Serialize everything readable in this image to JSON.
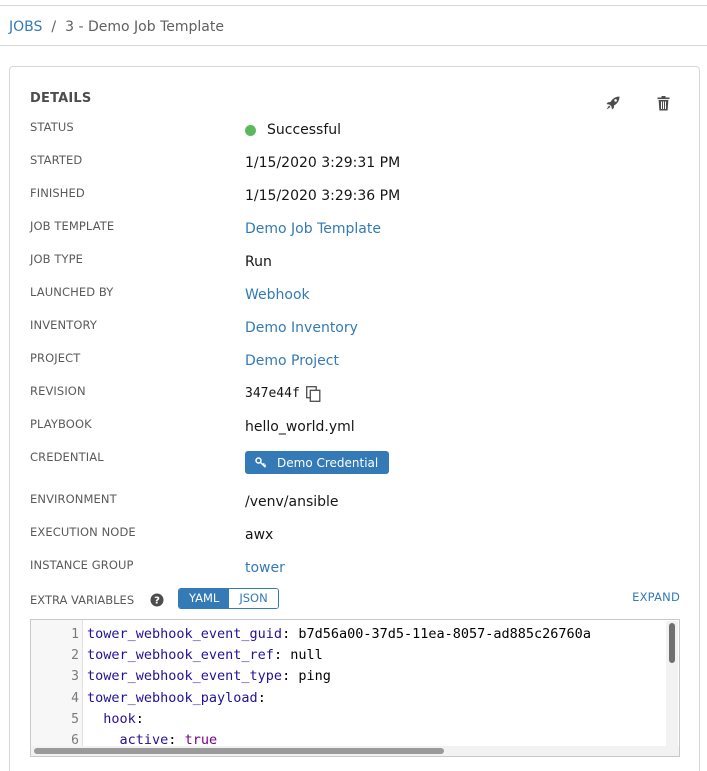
{
  "breadcrumb": {
    "root": "JOBS",
    "separator": "/",
    "current": "3 - Demo Job Template"
  },
  "panel": {
    "title": "DETAILS",
    "actions": [
      {
        "icon": "rocket-icon",
        "label": "Relaunch"
      },
      {
        "icon": "trash-icon",
        "label": "Delete"
      }
    ]
  },
  "details": {
    "status": {
      "label": "STATUS",
      "value": "Successful"
    },
    "started": {
      "label": "STARTED",
      "value": "1/15/2020 3:29:31 PM"
    },
    "finished": {
      "label": "FINISHED",
      "value": "1/15/2020 3:29:36 PM"
    },
    "job_template": {
      "label": "JOB TEMPLATE",
      "value": "Demo Job Template"
    },
    "job_type": {
      "label": "JOB TYPE",
      "value": "Run"
    },
    "launched_by": {
      "label": "LAUNCHED BY",
      "value": "Webhook"
    },
    "inventory": {
      "label": "INVENTORY",
      "value": "Demo Inventory"
    },
    "project": {
      "label": "PROJECT",
      "value": "Demo Project"
    },
    "revision": {
      "label": "REVISION",
      "value": "347e44f"
    },
    "playbook": {
      "label": "PLAYBOOK",
      "value": "hello_world.yml"
    },
    "credential": {
      "label": "CREDENTIAL",
      "value": "Demo Credential"
    },
    "environment": {
      "label": "ENVIRONMENT",
      "value": "/venv/ansible"
    },
    "execution_node": {
      "label": "EXECUTION NODE",
      "value": "awx"
    },
    "instance_group": {
      "label": "INSTANCE GROUP",
      "value": "tower"
    }
  },
  "extra_variables": {
    "label": "EXTRA VARIABLES",
    "modes": [
      "YAML",
      "JSON"
    ],
    "active_mode": "YAML",
    "expand_label": "EXPAND",
    "lines": [
      {
        "num": "1",
        "indent": "",
        "key": "tower_webhook_event_guid",
        "sep": ": ",
        "value": "b7d56a00-37d5-11ea-8057-ad885c26760a"
      },
      {
        "num": "2",
        "indent": "",
        "key": "tower_webhook_event_ref",
        "sep": ": ",
        "value": "null"
      },
      {
        "num": "3",
        "indent": "",
        "key": "tower_webhook_event_type",
        "sep": ": ",
        "value": "ping"
      },
      {
        "num": "4",
        "indent": "",
        "key": "tower_webhook_payload",
        "sep": ":",
        "value": ""
      },
      {
        "num": "5",
        "indent": "  ",
        "key": "hook",
        "sep": ":",
        "value": ""
      },
      {
        "num": "6",
        "indent": "    ",
        "key": "active",
        "sep": ": ",
        "value": "true"
      }
    ]
  },
  "colors": {
    "link": "#337ab7",
    "success": "#5cb85c"
  }
}
